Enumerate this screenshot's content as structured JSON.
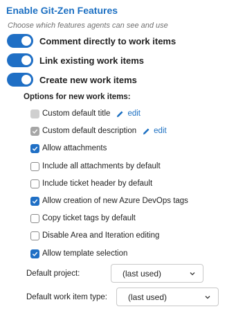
{
  "header": {
    "title": "Enable Git-Zen Features",
    "subtitle": "Choose which features agents can see and use"
  },
  "toggles": [
    {
      "label": "Comment directly to work items",
      "on": true
    },
    {
      "label": "Link existing work items",
      "on": true
    },
    {
      "label": "Create new work items",
      "on": true
    }
  ],
  "options": {
    "heading": "Options for new work items:",
    "edit_label": "edit",
    "items": [
      {
        "label": "Custom default title",
        "checked": false,
        "disabled": true
      },
      {
        "label": "Custom default description",
        "checked": true,
        "disabled": true
      },
      {
        "label": "Allow attachments",
        "checked": true,
        "disabled": false
      },
      {
        "label": "Include all attachments by default",
        "checked": false,
        "disabled": false
      },
      {
        "label": "Include ticket header by default",
        "checked": false,
        "disabled": false
      },
      {
        "label": "Allow creation of new Azure DevOps tags",
        "checked": true,
        "disabled": false
      },
      {
        "label": "Copy ticket tags by default",
        "checked": false,
        "disabled": false
      },
      {
        "label": "Disable Area and Iteration editing",
        "checked": false,
        "disabled": false
      },
      {
        "label": "Allow template selection",
        "checked": true,
        "disabled": false
      }
    ]
  },
  "fields": {
    "project": {
      "label": "Default project:",
      "value": "(last used)"
    },
    "work_item_type": {
      "label": "Default work item type:",
      "value": "(last used)"
    }
  },
  "colors": {
    "accent": "#1f6fc5",
    "title": "#1b6fc2"
  }
}
